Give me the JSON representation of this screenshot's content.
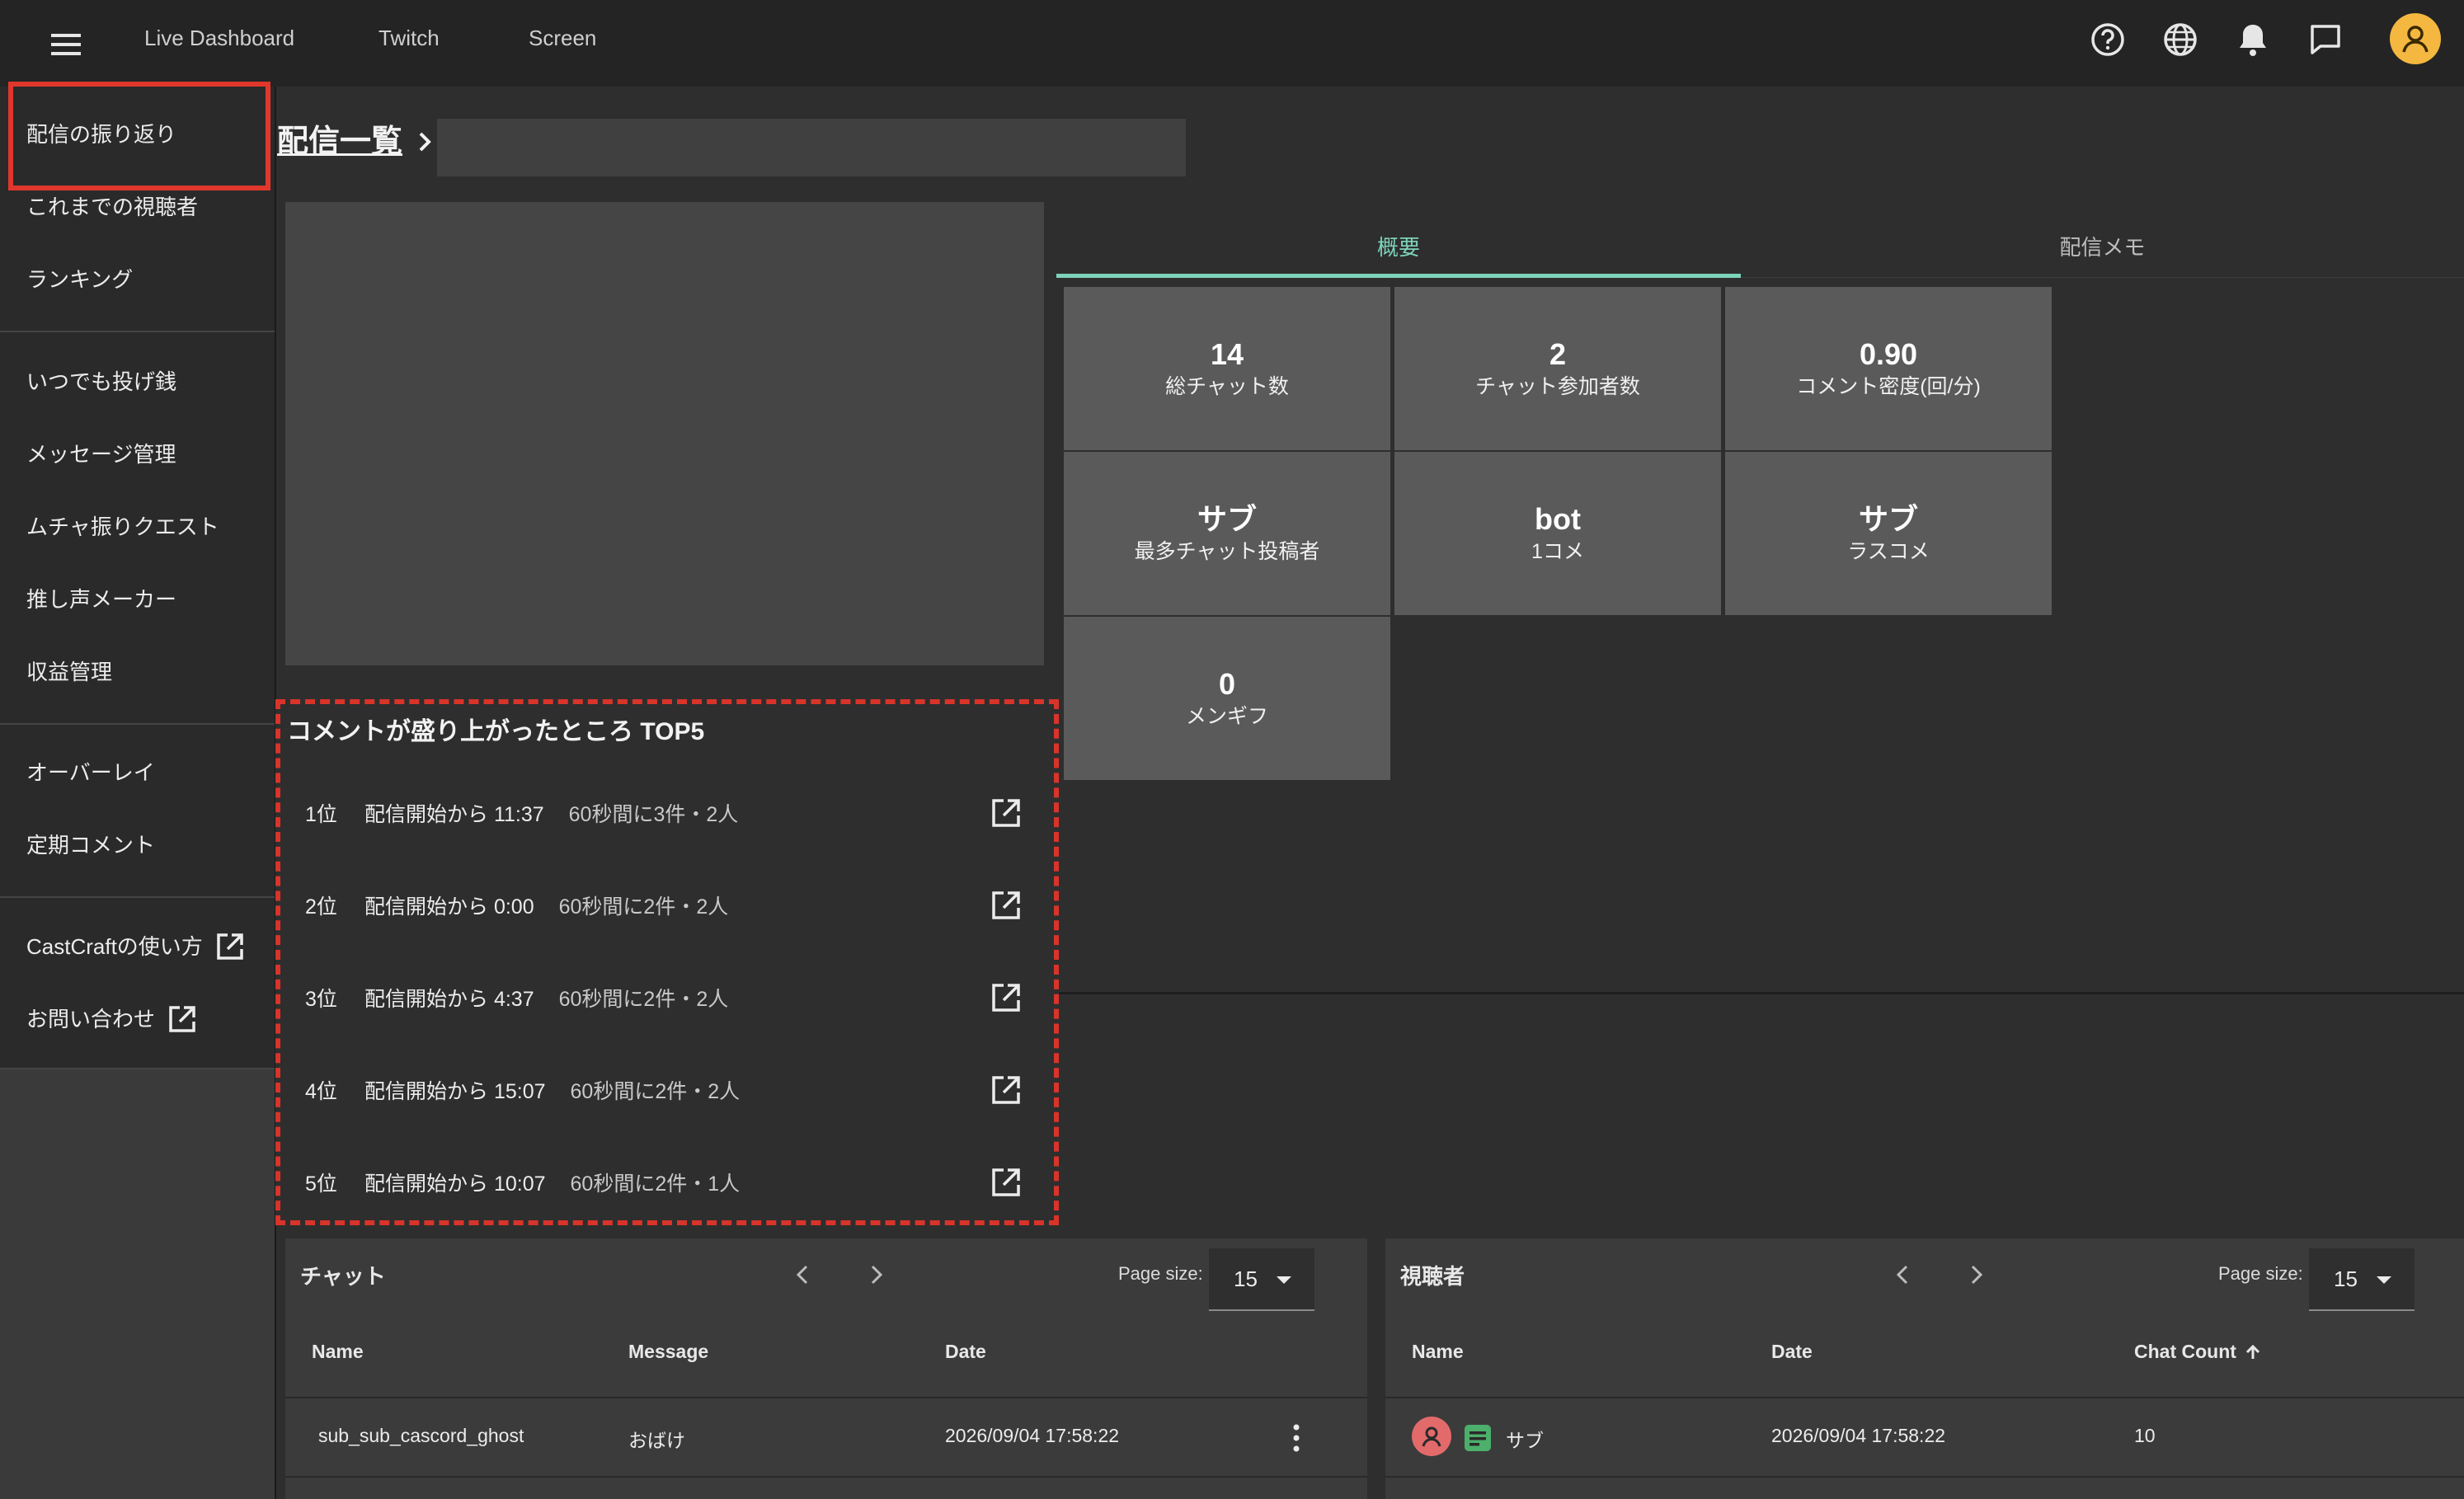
{
  "header": {
    "nav": [
      "Live Dashboard",
      "Twitch",
      "Screen"
    ],
    "icons": [
      "menu-icon",
      "help-icon",
      "globe-icon",
      "bell-icon",
      "chat-icon",
      "avatar-icon"
    ]
  },
  "sidebar": {
    "group1": [
      "配信の振り返り",
      "これまでの視聴者",
      "ランキング"
    ],
    "group2": [
      "いつでも投げ銭",
      "メッセージ管理",
      "ムチャ振りクエスト",
      "推し声メーカー",
      "収益管理"
    ],
    "group3": [
      "オーバーレイ",
      "定期コメント"
    ],
    "group4": [
      "CastCraftの使い方",
      "お問い合わせ"
    ]
  },
  "breadcrumb": {
    "title": "配信一覧"
  },
  "tabs": {
    "overview": "概要",
    "memo": "配信メモ"
  },
  "stats": [
    {
      "value": "14",
      "label": "総チャット数"
    },
    {
      "value": "2",
      "label": "チャット参加者数"
    },
    {
      "value": "0.90",
      "label": "コメント密度(回/分)"
    },
    {
      "value": "サブ",
      "label": "最多チャット投稿者"
    },
    {
      "value": "bot",
      "label": "1コメ"
    },
    {
      "value": "サブ",
      "label": "ラスコメ"
    },
    {
      "value": "0",
      "label": "メンギフ"
    }
  ],
  "top5": {
    "title": "コメントが盛り上がったところ TOP5",
    "items": [
      {
        "rank": "1位",
        "time": "配信開始から 11:37",
        "count": "60秒間に3件・2人"
      },
      {
        "rank": "2位",
        "time": "配信開始から 0:00",
        "count": "60秒間に2件・2人"
      },
      {
        "rank": "3位",
        "time": "配信開始から 4:37",
        "count": "60秒間に2件・2人"
      },
      {
        "rank": "4位",
        "time": "配信開始から 15:07",
        "count": "60秒間に2件・2人"
      },
      {
        "rank": "5位",
        "time": "配信開始から 10:07",
        "count": "60秒間に2件・1人"
      }
    ]
  },
  "chat_table": {
    "title": "チャット",
    "page_size_label": "Page size:",
    "page_size": "15",
    "columns": [
      "Name",
      "Message",
      "Date"
    ],
    "rows": [
      {
        "name": "sub_sub_cascord_ghost",
        "message": "おばけ",
        "date": "2026/09/04 17:58:22"
      }
    ]
  },
  "viewer_table": {
    "title": "視聴者",
    "page_size_label": "Page size:",
    "page_size": "15",
    "columns": [
      "Name",
      "Date",
      "Chat Count"
    ],
    "rows": [
      {
        "name": "サブ",
        "date": "2026/09/04 17:58:22",
        "chat_count": "10"
      }
    ]
  },
  "colors": {
    "accent": "#7dd3b9",
    "highlight": "#e0372c",
    "avatar": "#f4b740",
    "stat_bg": "#5a5a5a"
  }
}
